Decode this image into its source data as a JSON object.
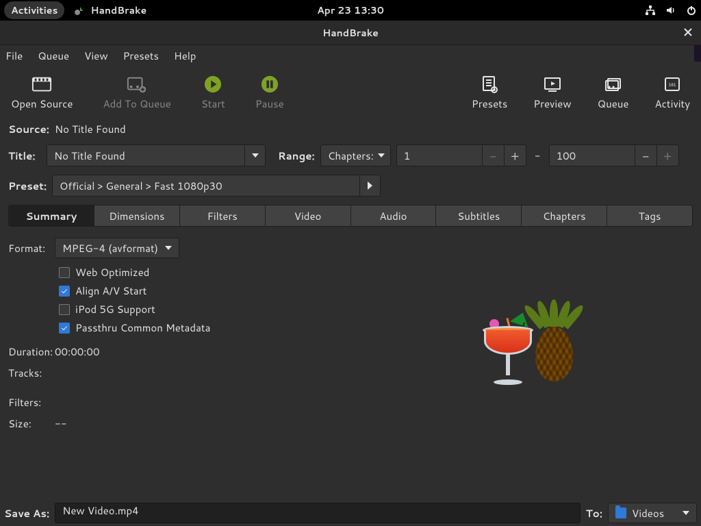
{
  "topbar": {
    "activities": "Activities",
    "app_name": "HandBrake",
    "clock": "Apr 23  13:30"
  },
  "window": {
    "title": "HandBrake"
  },
  "menu": {
    "items": [
      "File",
      "Queue",
      "View",
      "Presets",
      "Help"
    ]
  },
  "toolbar": {
    "open_source": "Open Source",
    "add_queue": "Add To Queue",
    "start": "Start",
    "pause": "Pause",
    "presets": "Presets",
    "preview": "Preview",
    "queue": "Queue",
    "activity": "Activity"
  },
  "source": {
    "label": "Source:",
    "value": "No Title Found"
  },
  "title": {
    "label": "Title:",
    "value": "No Title Found"
  },
  "range": {
    "label": "Range:",
    "mode": "Chapters:",
    "from": "1",
    "to": "100"
  },
  "preset": {
    "label": "Preset:",
    "value": "Official > General > Fast 1080p30"
  },
  "tabs": [
    "Summary",
    "Dimensions",
    "Filters",
    "Video",
    "Audio",
    "Subtitles",
    "Chapters",
    "Tags"
  ],
  "summary": {
    "format_label": "Format:",
    "format_value": "MPEG-4 (avformat)",
    "web_optimized_label": "Web Optimized",
    "align_av_label": "Align A/V Start",
    "ipod_label": "iPod 5G Support",
    "passthru_label": "Passthru Common Metadata",
    "web_optimized": false,
    "align_av": true,
    "ipod": false,
    "passthru": true,
    "duration_label": "Duration:",
    "duration_value": "00:00:00",
    "tracks_label": "Tracks:",
    "filters_label": "Filters:",
    "size_label": "Size:",
    "size_value": "--"
  },
  "save": {
    "label": "Save As:",
    "filename": "New Video.mp4",
    "to_label": "To:",
    "dest": "Videos"
  }
}
